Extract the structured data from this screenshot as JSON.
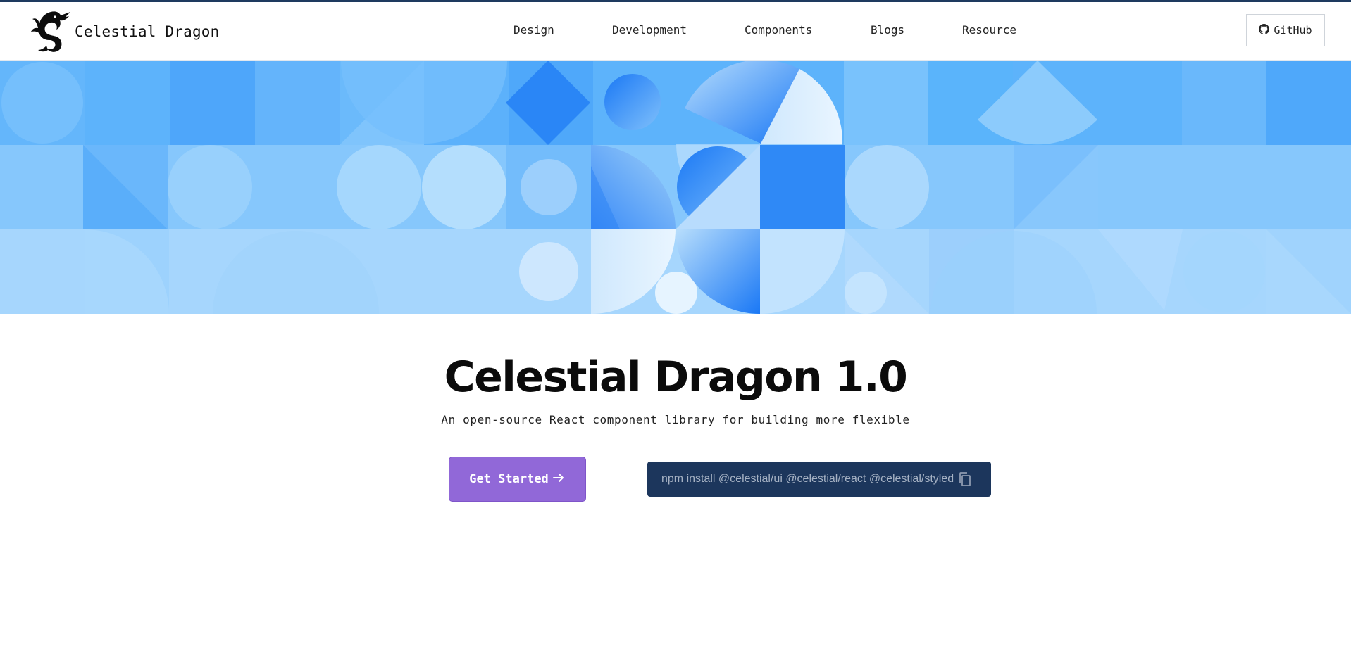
{
  "brand": {
    "name": "Celestial Dragon",
    "logo_icon": "dragon-logo-icon"
  },
  "nav": {
    "items": [
      {
        "label": "Design"
      },
      {
        "label": "Development"
      },
      {
        "label": "Components"
      },
      {
        "label": "Blogs"
      },
      {
        "label": "Resource"
      }
    ],
    "github": {
      "label": "GitHub",
      "icon": "github-icon"
    }
  },
  "hero": {
    "title": "Celestial Dragon 1.0",
    "subtitle": "An open-source React component library for building more flexible",
    "cta_label": "Get Started",
    "cta_icon": "arrow-right-icon",
    "install_command": "npm install @celestial/ui @celestial/react @celestial/styled",
    "copy_icon": "copy-icon"
  },
  "colors": {
    "top_accent": "#1e3a5f",
    "cta_background": "#9168d8",
    "install_background": "#1c365c",
    "banner_blue": "#1a78f5"
  }
}
